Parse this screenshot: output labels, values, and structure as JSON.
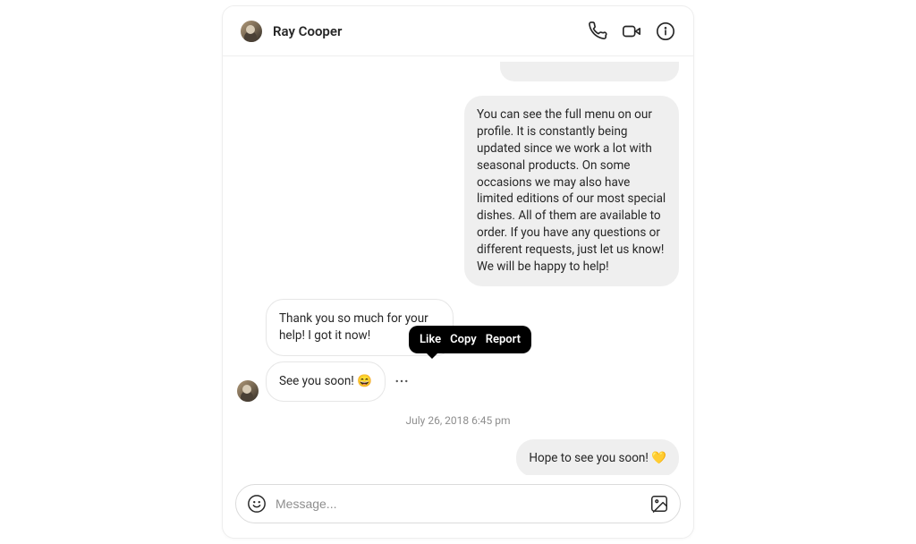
{
  "header": {
    "contact_name": "Ray Cooper"
  },
  "messages": {
    "menu_info": "You can see the full menu on our profile. It is constantly being updated since we work a lot with seasonal products. On some occasions we may also have limited editions of our most special dishes. All of them are available to order. If you have any questions or different requests, just let us know! We will be happy to help!",
    "thanks": "Thank you so much for your help! I got it now!",
    "see_you": "See you soon! 😄",
    "timestamp": "July 26, 2018 6:45 pm",
    "hope": "Hope to see you soon! 💛"
  },
  "tooltip": {
    "like": "Like",
    "copy": "Copy",
    "report": "Report"
  },
  "composer": {
    "placeholder": "Message..."
  }
}
